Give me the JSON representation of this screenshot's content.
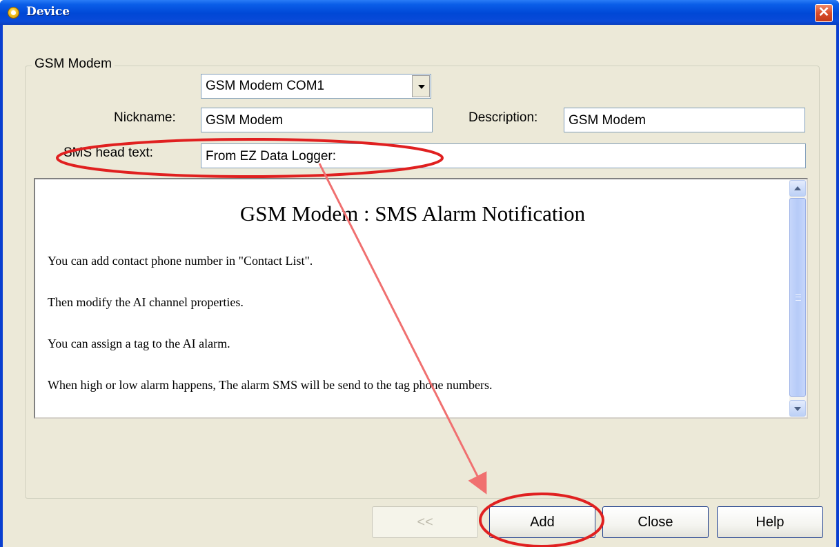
{
  "window": {
    "title": "Device"
  },
  "group": {
    "legend": "GSM Modem"
  },
  "device_select": {
    "value": "GSM Modem  COM1"
  },
  "form": {
    "nickname_label": "Nickname:",
    "nickname_value": "GSM Modem",
    "description_label": "Description:",
    "description_value": "GSM Modem",
    "sms_head_label": "SMS head text:",
    "sms_head_value": "From EZ Data Logger:"
  },
  "info_panel": {
    "heading": "GSM Modem : SMS Alarm Notification",
    "paragraphs": [
      "You can add contact phone number in \"Contact List\".",
      "Then modify the AI channel properties.",
      "You can assign a tag to the AI alarm.",
      "When high or low alarm happens, The alarm SMS will be send to the tag phone numbers."
    ]
  },
  "buttons": {
    "back": "<<",
    "add": "Add",
    "close": "Close",
    "help": "Help"
  },
  "colors": {
    "annotation": "#e02020",
    "arrow": "#f07070"
  }
}
